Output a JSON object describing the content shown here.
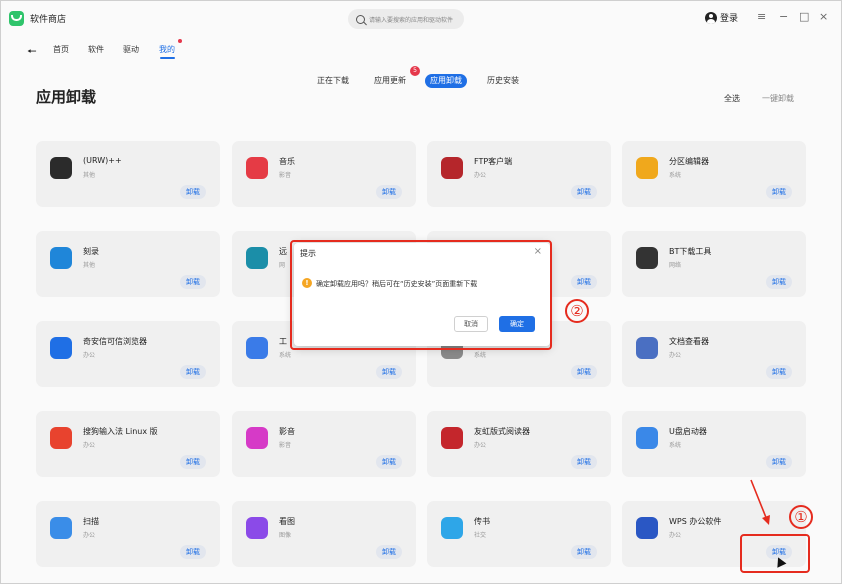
{
  "app": {
    "title": "软件商店"
  },
  "search": {
    "placeholder": "请输入要搜索的应用和驱动软件"
  },
  "header": {
    "login_label": "登录",
    "menu_icon": "≡",
    "minimize_icon": "−",
    "maximize_icon": "□",
    "close_icon": "×"
  },
  "nav": {
    "items": [
      {
        "label": "首页"
      },
      {
        "label": "软件"
      },
      {
        "label": "驱动"
      },
      {
        "label": "我的"
      }
    ],
    "active": "我的"
  },
  "page": {
    "title": "应用卸载",
    "select_all": "全选",
    "uninstall_all": "一键卸载"
  },
  "tabs": [
    {
      "label": "正在下载"
    },
    {
      "label": "应用更新",
      "badge": "5"
    },
    {
      "label": "应用卸载",
      "active": true
    },
    {
      "label": "历史安装"
    }
  ],
  "apps": [
    {
      "name": "(URW)++",
      "category": "其他",
      "button": "卸载",
      "icon": "gears-icon",
      "color": "#2b2b2b"
    },
    {
      "name": "音乐",
      "category": "影音",
      "button": "卸载",
      "icon": "music-icon",
      "color": "#e53b45"
    },
    {
      "name": "FTP客户端",
      "category": "办公",
      "button": "卸载",
      "icon": "filezilla-icon",
      "color": "#b5262b"
    },
    {
      "name": "分区编辑器",
      "category": "系统",
      "button": "卸载",
      "icon": "partition-icon",
      "color": "#f0a81c"
    },
    {
      "name": "刻录",
      "category": "其他",
      "button": "卸载",
      "icon": "disc-icon",
      "color": "#1f86d9"
    },
    {
      "name": "远",
      "category": "网",
      "button": "卸载",
      "icon": "remote-icon",
      "color": "#1b8ea8"
    },
    {
      "name": "",
      "category": "",
      "button": "卸载",
      "icon": "",
      "color": "#f0f0f0"
    },
    {
      "name": "BT下载工具",
      "category": "网络",
      "button": "卸载",
      "icon": "bt-icon",
      "color": "#333333"
    },
    {
      "name": "奇安信可信浏览器",
      "category": "办公",
      "button": "卸载",
      "icon": "browser-icon",
      "color": "#1f6fe5"
    },
    {
      "name": "工",
      "category": "系统",
      "button": "卸载",
      "icon": "toolbox-icon",
      "color": "#3a7be8"
    },
    {
      "name": "",
      "category": "系统",
      "button": "卸载",
      "icon": "package-icon",
      "color": "#8a8a8a"
    },
    {
      "name": "文档查看器",
      "category": "办公",
      "button": "卸载",
      "icon": "doc-viewer-icon",
      "color": "#4a6fc2"
    },
    {
      "name": "搜狗输入法 Linux 版",
      "category": "办公",
      "button": "卸载",
      "icon": "sogou-icon",
      "color": "#e8432e"
    },
    {
      "name": "影音",
      "category": "影音",
      "button": "卸载",
      "icon": "video-icon",
      "color": "#d63ac7"
    },
    {
      "name": "友虹版式阅读器",
      "category": "办公",
      "button": "卸载",
      "icon": "ofd-icon",
      "color": "#c4262c"
    },
    {
      "name": "U盘启动器",
      "category": "系统",
      "button": "卸载",
      "icon": "usb-icon",
      "color": "#3a88e8"
    },
    {
      "name": "扫描",
      "category": "办公",
      "button": "卸载",
      "icon": "scanner-icon",
      "color": "#3a8de8"
    },
    {
      "name": "看图",
      "category": "图像",
      "button": "卸载",
      "icon": "image-viewer-icon",
      "color": "#8b4ae8"
    },
    {
      "name": "传书",
      "category": "社交",
      "button": "卸载",
      "icon": "send-icon",
      "color": "#2ea6e8"
    },
    {
      "name": "WPS 办公软件",
      "category": "办公",
      "button": "卸载",
      "icon": "wps-icon",
      "color": "#2a57c4"
    }
  ],
  "dialog": {
    "title": "提示",
    "message": "确定卸载应用吗？稍后可在“历史安装”页面重新下载",
    "cancel": "取消",
    "ok": "确定"
  },
  "annotations": {
    "step1": "①",
    "step2": "②"
  },
  "colors": {
    "accent": "#1f6fe5",
    "annotation": "#e52b1e"
  }
}
